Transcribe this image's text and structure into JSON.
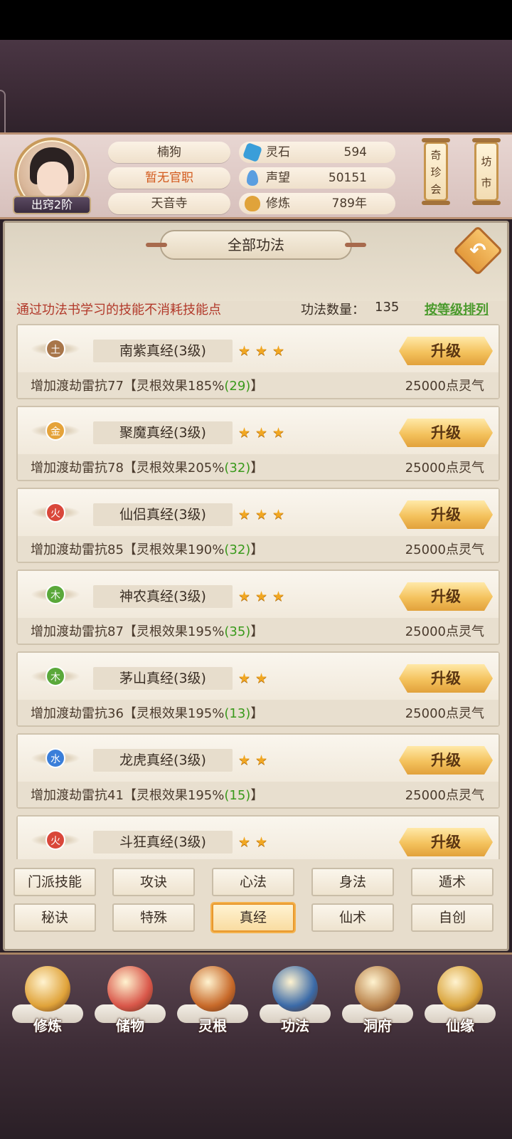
{
  "colors": {
    "accent_red": "#b2392a",
    "accent_green": "#4a9a2c",
    "button_gold": "#f4c25d",
    "star_gold": "#f1a722"
  },
  "player": {
    "name": "楠狗",
    "title": "暂无官职",
    "sect": "天音寺",
    "rank": "出窍2阶"
  },
  "stats": [
    {
      "icon": "spirit-stone-icon",
      "label": "灵石",
      "value": "594"
    },
    {
      "icon": "reputation-icon",
      "label": "声望",
      "value": "50151"
    },
    {
      "icon": "cultivation-icon",
      "label": "修炼",
      "value": "789年"
    }
  ],
  "header_buttons": {
    "treasure": "奇珍会",
    "market": "坊市"
  },
  "panel": {
    "title": "全部功法",
    "notice": "通过功法书学习的技能不消耗技能点",
    "count_label": "功法数量：",
    "count_value": "135",
    "sort_label": "按等级排列"
  },
  "skills": [
    {
      "element": "土",
      "element_color": "#a8764a",
      "name": "南紫真经(3级)",
      "stars": 3,
      "upgrade": "升级",
      "desc_prefix": "增加渡劫雷抗77【灵根效果185%",
      "desc_num": "(29)",
      "desc_suffix": "】",
      "cost": "25000点灵气"
    },
    {
      "element": "金",
      "element_color": "#e5a33a",
      "name": "聚魔真经(3级)",
      "stars": 3,
      "upgrade": "升级",
      "desc_prefix": "增加渡劫雷抗78【灵根效果205%",
      "desc_num": "(32)",
      "desc_suffix": "】",
      "cost": "25000点灵气"
    },
    {
      "element": "火",
      "element_color": "#d9473a",
      "name": "仙侣真经(3级)",
      "stars": 3,
      "upgrade": "升级",
      "desc_prefix": "增加渡劫雷抗85【灵根效果190%",
      "desc_num": "(32)",
      "desc_suffix": "】",
      "cost": "25000点灵气"
    },
    {
      "element": "木",
      "element_color": "#5aa83a",
      "name": "神农真经(3级)",
      "stars": 3,
      "upgrade": "升级",
      "desc_prefix": "增加渡劫雷抗87【灵根效果195%",
      "desc_num": "(35)",
      "desc_suffix": "】",
      "cost": "25000点灵气"
    },
    {
      "element": "木",
      "element_color": "#5aa83a",
      "name": "茅山真经(3级)",
      "stars": 2,
      "upgrade": "升级",
      "desc_prefix": "增加渡劫雷抗36【灵根效果195%",
      "desc_num": "(13)",
      "desc_suffix": "】",
      "cost": "25000点灵气"
    },
    {
      "element": "水",
      "element_color": "#3a7ed9",
      "name": "龙虎真经(3级)",
      "stars": 2,
      "upgrade": "升级",
      "desc_prefix": "增加渡劫雷抗41【灵根效果195%",
      "desc_num": "(15)",
      "desc_suffix": "】",
      "cost": "25000点灵气"
    },
    {
      "element": "火",
      "element_color": "#d9473a",
      "name": "斗狂真经(3级)",
      "stars": 2,
      "upgrade": "升级",
      "desc_prefix": "",
      "desc_num": "",
      "desc_suffix": "",
      "cost": ""
    }
  ],
  "categories": [
    {
      "label": "门派技能",
      "active": false
    },
    {
      "label": "攻诀",
      "active": false
    },
    {
      "label": "心法",
      "active": false
    },
    {
      "label": "身法",
      "active": false
    },
    {
      "label": "遁术",
      "active": false
    },
    {
      "label": "秘诀",
      "active": false
    },
    {
      "label": "特殊",
      "active": false
    },
    {
      "label": "真经",
      "active": true
    },
    {
      "label": "仙术",
      "active": false
    },
    {
      "label": "自创",
      "active": false
    }
  ],
  "bottom_nav": [
    {
      "label": "修炼",
      "icon": "cultivation-monk-icon",
      "color": "#e0a33a"
    },
    {
      "label": "储物",
      "icon": "storage-bag-icon",
      "color": "#d9574a"
    },
    {
      "label": "灵根",
      "icon": "spirit-root-icon",
      "color": "#c86a2a"
    },
    {
      "label": "功法",
      "icon": "skill-book-icon",
      "color": "#3a6aa8"
    },
    {
      "label": "洞府",
      "icon": "cave-house-icon",
      "color": "#b9824a"
    },
    {
      "label": "仙缘",
      "icon": "destiny-gourd-icon",
      "color": "#d9a33a"
    }
  ]
}
